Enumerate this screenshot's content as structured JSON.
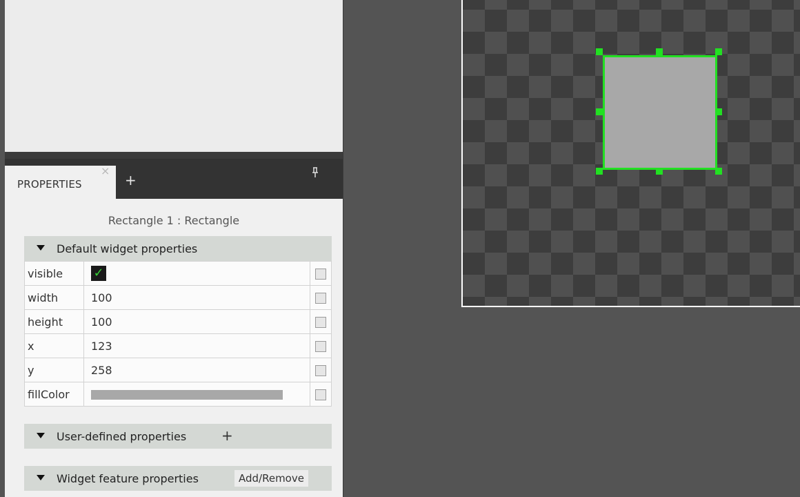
{
  "properties_tab": {
    "label": "PROPERTIES",
    "close": "×",
    "add": "+",
    "pin": "⚲"
  },
  "selection_title": "Rectangle 1 : Rectangle",
  "sections": {
    "default": "Default widget properties",
    "user_defined": "User-defined properties",
    "user_defined_add": "+",
    "widget_feature": "Widget feature properties",
    "widget_feature_btn": "Add/Remove"
  },
  "props": [
    {
      "name": "visible",
      "value": "",
      "checked": true
    },
    {
      "name": "width",
      "value": "100"
    },
    {
      "name": "height",
      "value": "100"
    },
    {
      "name": "x",
      "value": "123"
    },
    {
      "name": "y",
      "value": "258"
    },
    {
      "name": "fillColor",
      "value": "",
      "color": "#a8a8a8"
    }
  ],
  "canvas": {
    "rect_fill": "#a8a8a8",
    "selection_color": "#22e022"
  }
}
